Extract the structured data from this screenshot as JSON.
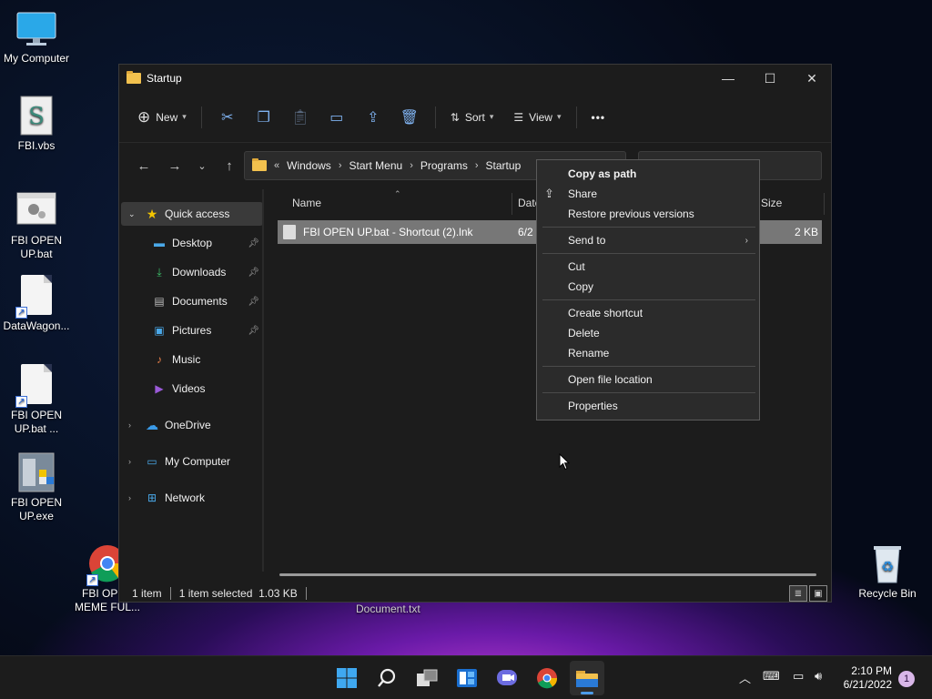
{
  "desktop": {
    "icons": [
      {
        "label": "My Computer"
      },
      {
        "label": "FBI.vbs"
      },
      {
        "label": "FBI OPEN UP.bat"
      },
      {
        "label": "DataWagon..."
      },
      {
        "label": "FBI OPEN UP.bat ..."
      },
      {
        "label": "FBI OPEN UP.exe"
      },
      {
        "label": "FBI OPEN MEME FUL..."
      },
      {
        "label": "Recycle Bin"
      }
    ],
    "behind_window_label": "Document.txt"
  },
  "window": {
    "title": "Startup",
    "controls": {
      "minimize": "—",
      "maximize": "☐",
      "close": "✕"
    }
  },
  "toolbar": {
    "new_label": "New",
    "sort_label": "Sort",
    "view_label": "View",
    "more_label": "•••"
  },
  "address": {
    "prefix": "«",
    "crumbs": [
      "Windows",
      "Start Menu",
      "Programs",
      "Startup"
    ]
  },
  "sidebar": {
    "items": [
      {
        "label": "Quick access"
      },
      {
        "label": "Desktop"
      },
      {
        "label": "Downloads"
      },
      {
        "label": "Documents"
      },
      {
        "label": "Pictures"
      },
      {
        "label": "Music"
      },
      {
        "label": "Videos"
      },
      {
        "label": "OneDrive"
      },
      {
        "label": "My Computer"
      },
      {
        "label": "Network"
      }
    ]
  },
  "files": {
    "columns": {
      "name": "Name",
      "date": "Date",
      "size": "Size"
    },
    "rows": [
      {
        "name": "FBI OPEN UP.bat - Shortcut (2).lnk",
        "date": "6/2",
        "size": "2 KB"
      }
    ]
  },
  "status": {
    "count": "1 item",
    "selected": "1 item selected  1.03 KB"
  },
  "context_menu": {
    "items": [
      {
        "label": "Copy as path"
      },
      {
        "label": "Share"
      },
      {
        "label": "Restore previous versions"
      },
      {
        "label": "Send to"
      },
      {
        "label": "Cut"
      },
      {
        "label": "Copy"
      },
      {
        "label": "Create shortcut"
      },
      {
        "label": "Delete"
      },
      {
        "label": "Rename"
      },
      {
        "label": "Open file location"
      },
      {
        "label": "Properties"
      }
    ]
  },
  "taskbar": {
    "time": "2:10 PM",
    "date": "6/21/2022",
    "notification_count": "1"
  },
  "colors": {
    "accent": "#4c9be8",
    "window_bg": "#1c1c1c",
    "selected_row": "#777777"
  }
}
